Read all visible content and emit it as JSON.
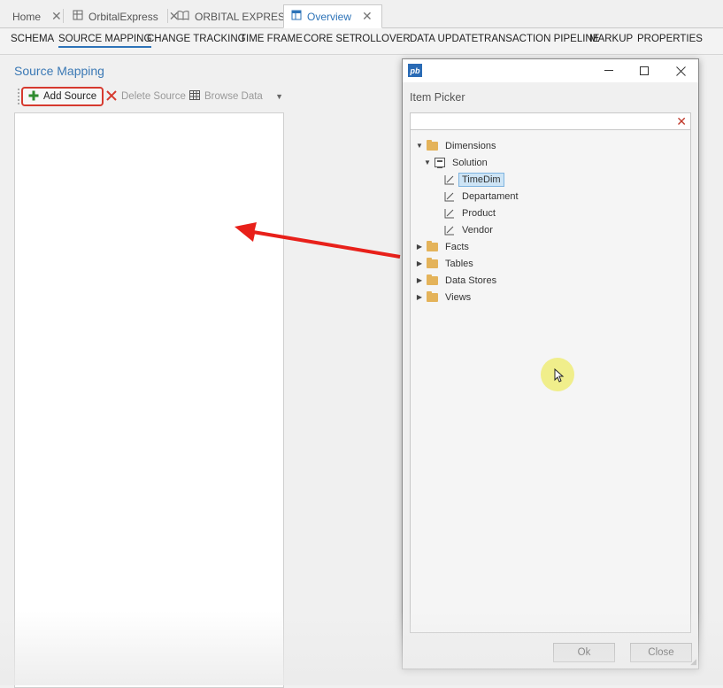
{
  "doc_tabs": [
    {
      "label": "Home",
      "icon": "none"
    },
    {
      "label": "OrbitalExpress",
      "icon": "database-icon"
    },
    {
      "label": "ORBITAL EXPRES",
      "icon": "book-icon"
    },
    {
      "label": "Overview",
      "icon": "grid-icon"
    }
  ],
  "ribbon": [
    "SCHEMA",
    "SOURCE MAPPING",
    "CHANGE TRACKING",
    "TIME FRAME",
    "CORE SET",
    "ROLLOVER",
    "DATA UPDATE",
    "TRANSACTION PIPELINE",
    "MARKUP",
    "PROPERTIES"
  ],
  "ribbon_active": "SOURCE MAPPING",
  "pane": {
    "title": "Source Mapping",
    "toolbar": {
      "add": "Add Source",
      "delete": "Delete Source",
      "browse": "Browse Data"
    }
  },
  "dialog": {
    "app_icon": "pb",
    "heading": "Item Picker",
    "search_value": "",
    "tree": [
      {
        "label": "Dimensions",
        "level": 0,
        "expanded": true,
        "icon": "folder-icon"
      },
      {
        "label": "Solution",
        "level": 1,
        "expanded": true,
        "icon": "solution-icon"
      },
      {
        "label": "TimeDim",
        "level": 2,
        "icon": "dimension-icon",
        "selected": true
      },
      {
        "label": "Departament",
        "level": 2,
        "icon": "dimension-icon"
      },
      {
        "label": "Product",
        "level": 2,
        "icon": "dimension-icon"
      },
      {
        "label": "Vendor",
        "level": 2,
        "icon": "dimension-icon"
      },
      {
        "label": "Facts",
        "level": 0,
        "expanded": false,
        "icon": "folder-icon"
      },
      {
        "label": "Tables",
        "level": 0,
        "expanded": false,
        "icon": "folder-icon"
      },
      {
        "label": "Data Stores",
        "level": 0,
        "expanded": false,
        "icon": "folder-icon"
      },
      {
        "label": "Views",
        "level": 0,
        "expanded": false,
        "icon": "folder-icon"
      }
    ],
    "ok_label": "Ok",
    "close_label": "Close"
  },
  "colors": {
    "accent": "#2d73b8",
    "annotation_red": "#e8201a",
    "folder": "#e4b35a",
    "selection": "#cde4f5"
  }
}
